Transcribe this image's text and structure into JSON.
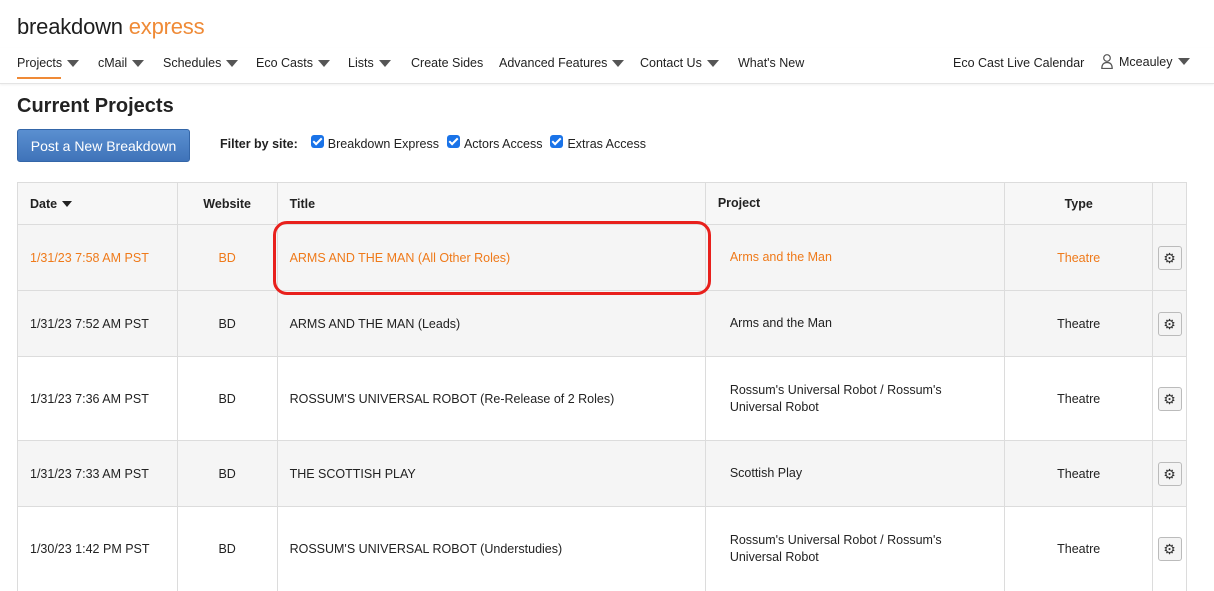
{
  "brand": {
    "word1": "breakdown",
    "word2": "express"
  },
  "nav": {
    "items": [
      {
        "label": "Projects",
        "dropdown": true
      },
      {
        "label": "cMail",
        "dropdown": true
      },
      {
        "label": "Schedules",
        "dropdown": true
      },
      {
        "label": "Eco Casts",
        "dropdown": true
      },
      {
        "label": "Lists",
        "dropdown": true
      },
      {
        "label": "Create Sides",
        "dropdown": false
      },
      {
        "label": "Advanced Features",
        "dropdown": true
      },
      {
        "label": "Contact Us",
        "dropdown": true
      },
      {
        "label": "What's New",
        "dropdown": false
      }
    ],
    "active": "Projects",
    "calendar_link": "Eco Cast Live Calendar",
    "user": "Mceauley"
  },
  "page_title": "Current Projects",
  "post_button": "Post a New Breakdown",
  "filter": {
    "label": "Filter by site:",
    "options": [
      {
        "label": "Breakdown Express",
        "checked": true
      },
      {
        "label": "Actors Access",
        "checked": true
      },
      {
        "label": "Extras Access",
        "checked": true
      }
    ]
  },
  "table": {
    "headers": {
      "date": "Date",
      "website": "Website",
      "title": "Title",
      "project": "Project",
      "type": "Type"
    },
    "rows": [
      {
        "date": "1/31/23 7:58 AM PST",
        "website": "BD",
        "title": "ARMS AND THE MAN (All Other Roles)",
        "project": "Arms and the Man",
        "type": "Theatre",
        "highlighted": true
      },
      {
        "date": "1/31/23 7:52 AM PST",
        "website": "BD",
        "title": "ARMS AND THE MAN (Leads)",
        "project": "Arms and the Man",
        "type": "Theatre"
      },
      {
        "date": "1/31/23 7:36 AM PST",
        "website": "BD",
        "title": "ROSSUM'S UNIVERSAL ROBOT (Re-Release of 2 Roles)",
        "project": "Rossum's Universal Robot / Rossum's Universal Robot",
        "type": "Theatre"
      },
      {
        "date": "1/31/23 7:33 AM PST",
        "website": "BD",
        "title": "THE SCOTTISH PLAY",
        "project": "Scottish Play",
        "type": "Theatre"
      },
      {
        "date": "1/30/23 1:42 PM PST",
        "website": "BD",
        "title": "ROSSUM'S UNIVERSAL ROBOT (Understudies)",
        "project": "Rossum's Universal Robot / Rossum's Universal Robot",
        "type": "Theatre"
      }
    ]
  },
  "colors": {
    "accent": "#ef8a36",
    "highlight_row_text": "#ef7a1a",
    "button_blue": "#4a7fc4",
    "annotation_red": "#e8201c"
  },
  "icons": {
    "row_action": "gear-icon",
    "user": "user-icon",
    "dropdown": "caret-down-icon"
  }
}
